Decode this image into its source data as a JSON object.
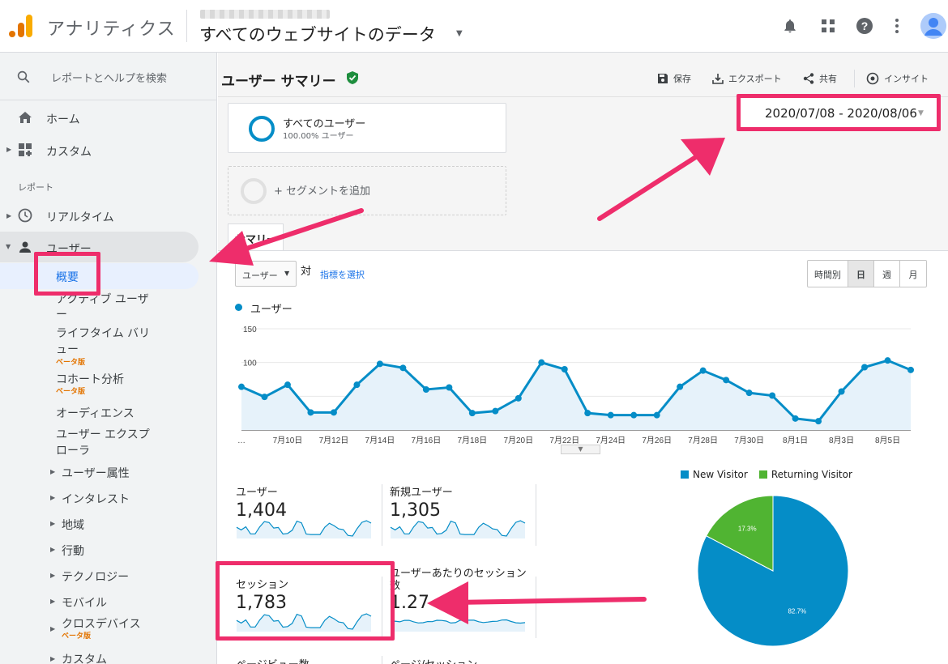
{
  "app": {
    "name": "アナリティクス",
    "property_title": "すべてのウェブサイトのデータ"
  },
  "topbar_icons": [
    "bell-icon",
    "apps-grid-icon",
    "help-icon",
    "more-vert-icon",
    "account-avatar-icon"
  ],
  "sidebar": {
    "search_placeholder": "レポートとヘルプを検索",
    "home": "ホーム",
    "custom": "カスタム",
    "section_reports": "レポート",
    "realtime": "リアルタイム",
    "users": "ユーザー",
    "overview": "概要",
    "active_users_1": "アクティブ ユーザ",
    "active_users_2": "ー",
    "lifetime_1": "ライフタイム バリ",
    "lifetime_2": "ュー",
    "beta": "ベータ版",
    "cohort": "コホート分析",
    "audience": "オーディエンス",
    "explorer_1": "ユーザー エクスプ",
    "explorer_2": "ローラ",
    "demographics": "ユーザー属性",
    "interests": "インタレスト",
    "geo": "地域",
    "behavior": "行動",
    "technology": "テクノロジー",
    "mobile": "モバイル",
    "cross_device": "クロスデバイス",
    "custom2": "カスタム"
  },
  "report": {
    "title": "ユーザー サマリー",
    "save": "保存",
    "export": "エクスポート",
    "share": "共有",
    "insights": "インサイト",
    "segment_name": "すべてのユーザー",
    "segment_sub": "100.00% ユーザー",
    "add_segment": "+ セグメントを追加",
    "date_range": "2020/07/08 - 2020/08/06",
    "summary_tab": "サマリー",
    "metric_select": "ユーザー",
    "vs": "対",
    "pick_metric": "指標を選択",
    "granularity": [
      "時間別",
      "日",
      "週",
      "月"
    ],
    "granularity_active": "日",
    "legend_series": "ユーザー"
  },
  "chart_data": [
    {
      "type": "area",
      "series": [
        {
          "name": "ユーザー",
          "color": "#058dc7",
          "values": [
            64,
            49,
            67,
            26,
            26,
            67,
            98,
            92,
            60,
            63,
            25,
            28,
            47,
            100,
            90,
            25,
            22,
            22,
            22,
            64,
            88,
            74,
            55,
            51,
            17,
            13,
            57,
            93,
            103,
            89
          ]
        }
      ],
      "x": [
        "7/8",
        "7/9",
        "7/10",
        "7/11",
        "7/12",
        "7/13",
        "7/14",
        "7/15",
        "7/16",
        "7/17",
        "7/18",
        "7/19",
        "7/20",
        "7/21",
        "7/22",
        "7/23",
        "7/24",
        "7/25",
        "7/26",
        "7/27",
        "7/28",
        "7/29",
        "7/30",
        "7/31",
        "8/1",
        "8/2",
        "8/3",
        "8/4",
        "8/5",
        "8/6"
      ],
      "x_tick_labels": [
        "…",
        "7月10日",
        "7月12日",
        "7月14日",
        "7月16日",
        "7月18日",
        "7月20日",
        "7月22日",
        "7月24日",
        "7月26日",
        "7月28日",
        "7月30日",
        "8月1日",
        "8月3日",
        "8月5日"
      ],
      "y_ticks": [
        "150",
        "100",
        "50"
      ],
      "ylim": [
        0,
        150
      ],
      "grid": true
    },
    {
      "type": "pie",
      "categories": [
        "New Visitor",
        "Returning Visitor"
      ],
      "values": [
        82.7,
        17.3
      ],
      "labels": [
        "82.7%",
        "17.3%"
      ],
      "colors": [
        "#058dc7",
        "#50b432"
      ],
      "legend": "top"
    }
  ],
  "metrics": [
    {
      "label": "ユーザー",
      "value": "1,404"
    },
    {
      "label": "新規ユーザー",
      "value": "1,305"
    },
    {
      "label": "セッション",
      "value": "1,783"
    },
    {
      "label_1": "ユーザーあたりのセッション",
      "label_2": "数",
      "value": "1.27"
    },
    {
      "label": "ページビュー数"
    },
    {
      "label": "ページ/セッション"
    }
  ],
  "colors": {
    "accent": "#058dc7",
    "returning": "#50b432",
    "annotation": "#ee2d6b"
  }
}
